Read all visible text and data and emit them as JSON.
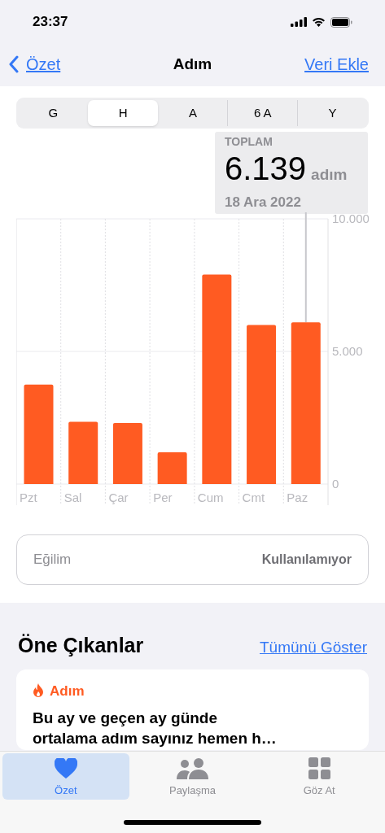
{
  "status_bar": {
    "time": "23:37"
  },
  "nav": {
    "back": "Özet",
    "title": "Adım",
    "action": "Veri Ekle"
  },
  "segments": [
    {
      "label": "G",
      "selected": false
    },
    {
      "label": "H",
      "selected": true
    },
    {
      "label": "A",
      "selected": false
    },
    {
      "label": "6 A",
      "selected": false
    },
    {
      "label": "Y",
      "selected": false
    }
  ],
  "summary": {
    "label": "TOPLAM",
    "value": "6.139",
    "unit": "adım",
    "date": "18 Ara 2022"
  },
  "chart": {
    "chart_data": {
      "type": "bar",
      "categories": [
        "Pzt",
        "Sal",
        "Çar",
        "Per",
        "Cum",
        "Cmt",
        "Paz"
      ],
      "series": [
        {
          "color": "#ff5b22",
          "values": [
            3750,
            2350,
            2300,
            1200,
            7900,
            6000,
            6100
          ]
        }
      ],
      "ylim": [
        0,
        10000
      ],
      "yticks": [
        {
          "value": 0,
          "label": "0"
        },
        {
          "value": 5000,
          "label": "5.000"
        },
        {
          "value": 10000,
          "label": "10.000"
        }
      ]
    }
  },
  "trend": {
    "label": "Eğilim",
    "value": "Kullanılamıyor"
  },
  "highlights": {
    "title": "Öne Çıkanlar",
    "link": "Tümünü Göster",
    "card": {
      "category": "Adım",
      "text": "Bu ay ve geçen ay günde ortalama adım sayınız hemen h…"
    }
  },
  "tab_bar": [
    {
      "label": "Özet",
      "selected": true
    },
    {
      "label": "Paylaşma",
      "selected": false
    },
    {
      "label": "Göz At",
      "selected": false
    }
  ]
}
